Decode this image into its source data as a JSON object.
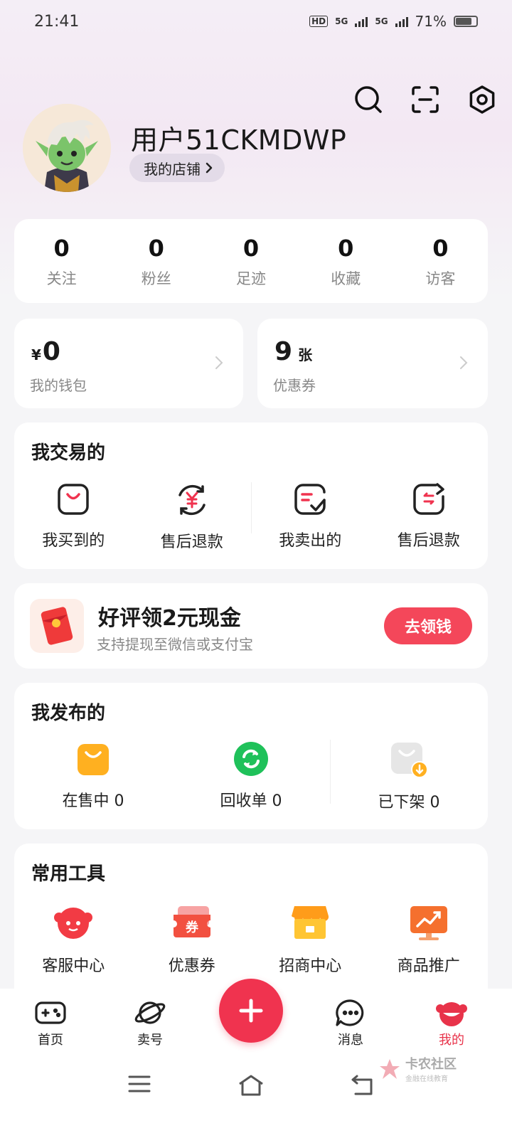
{
  "status_bar": {
    "time": "21:41",
    "net1": "5G",
    "net2": "5G",
    "battery": "71%"
  },
  "profile": {
    "username": "用户51CKMDWP",
    "store_label": "我的店铺"
  },
  "stats": [
    {
      "value": "0",
      "label": "关注"
    },
    {
      "value": "0",
      "label": "粉丝"
    },
    {
      "value": "0",
      "label": "足迹"
    },
    {
      "value": "0",
      "label": "收藏"
    },
    {
      "value": "0",
      "label": "访客"
    }
  ],
  "wallet": {
    "currency": "¥",
    "amount": "0",
    "label": "我的钱包"
  },
  "coupon": {
    "count": "9",
    "unit": "张",
    "label": "优惠券"
  },
  "trade": {
    "title": "我交易的",
    "items": [
      {
        "label": "我买到的"
      },
      {
        "label": "售后退款"
      },
      {
        "label": "我卖出的"
      },
      {
        "label": "售后退款"
      }
    ]
  },
  "promo": {
    "title": "好评领2元现金",
    "subtitle": "支持提现至微信或支付宝",
    "button": "去领钱"
  },
  "publish": {
    "title": "我发布的",
    "items": [
      {
        "label": "在售中 0"
      },
      {
        "label": "回收单 0"
      },
      {
        "label": "已下架 0"
      }
    ]
  },
  "tools": {
    "title": "常用工具",
    "items": [
      {
        "label": "客服中心"
      },
      {
        "label": "优惠券"
      },
      {
        "label": "招商中心"
      },
      {
        "label": "商品推广"
      }
    ]
  },
  "tabbar": {
    "items": [
      {
        "label": "首页"
      },
      {
        "label": "卖号"
      },
      {
        "label": "消息"
      },
      {
        "label": "我的"
      }
    ]
  },
  "watermark": {
    "text": "卡农社区",
    "sub": "金融在线教育"
  },
  "colors": {
    "accent": "#f0334f",
    "active_tab": "#e8334a",
    "orange": "#ffb020",
    "green": "#1fc15a"
  }
}
